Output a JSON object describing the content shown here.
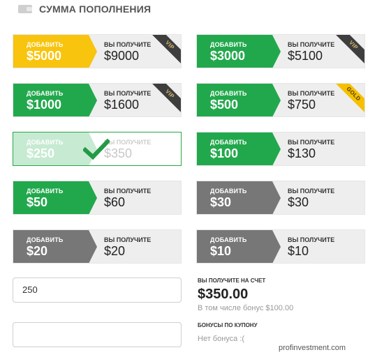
{
  "header": {
    "title": "СУММА ПОПОЛНЕНИЯ",
    "icon": "wallet-icon"
  },
  "cards": [
    {
      "add_label": "ДОБАВИТЬ",
      "add_amount": "$5000",
      "get_label": "ВЫ ПОЛУЧИТЕ",
      "get_amount": "$9000",
      "badge": "VIP"
    },
    {
      "add_label": "ДОБАВИТЬ",
      "add_amount": "$3000",
      "get_label": "ВЫ ПОЛУЧИТЕ",
      "get_amount": "$5100",
      "badge": "VIP"
    },
    {
      "add_label": "ДОБАВИТЬ",
      "add_amount": "$1000",
      "get_label": "ВЫ ПОЛУЧИТЕ",
      "get_amount": "$1600",
      "badge": "VIP"
    },
    {
      "add_label": "ДОБАВИТЬ",
      "add_amount": "$500",
      "get_label": "ВЫ ПОЛУЧИТЕ",
      "get_amount": "$750",
      "badge": "GOLD"
    },
    {
      "add_label": "ДОБАВИТЬ",
      "add_amount": "$250",
      "get_label": "ВЫ ПОЛУЧИТЕ",
      "get_amount": "$350",
      "selected": true
    },
    {
      "add_label": "ДОБАВИТЬ",
      "add_amount": "$100",
      "get_label": "ВЫ ПОЛУЧИТЕ",
      "get_amount": "$130"
    },
    {
      "add_label": "ДОБАВИТЬ",
      "add_amount": "$50",
      "get_label": "ВЫ ПОЛУЧИТЕ",
      "get_amount": "$60"
    },
    {
      "add_label": "ДОБАВИТЬ",
      "add_amount": "$30",
      "get_label": "ВЫ ПОЛУЧИТЕ",
      "get_amount": "$30"
    },
    {
      "add_label": "ДОБАВИТЬ",
      "add_amount": "$20",
      "get_label": "ВЫ ПОЛУЧИТЕ",
      "get_amount": "$20"
    },
    {
      "add_label": "ДОБАВИТЬ",
      "add_amount": "$10",
      "get_label": "ВЫ ПОЛУЧИТЕ",
      "get_amount": "$10"
    }
  ],
  "amount_input": {
    "value": "250"
  },
  "coupon_input": {
    "value": ""
  },
  "summary": {
    "receive_label": "ВЫ ПОЛУЧИТЕ НА СЧЕТ",
    "total": "$350.00",
    "bonus_note": "В том числе бонус $100.00",
    "coupon_label": "БОНУСЫ ПО КУПОНУ",
    "coupon_status": "Нет бонуса :("
  },
  "watermark": "profinvestment.com",
  "colors": {
    "green": "#22a84c",
    "yellow": "#f8c40d",
    "grey": "#777777",
    "vip_ribbon": "#3e3e3e",
    "gold_ribbon": "#f5c000"
  }
}
